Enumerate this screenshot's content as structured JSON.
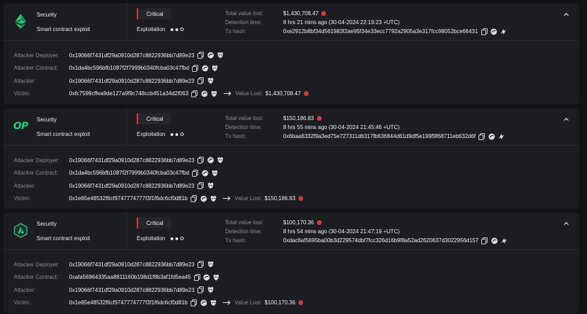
{
  "colors": {
    "background": "#121317",
    "card": "#1c1d22",
    "critical_red": "#d13a3a",
    "optimism_green": "#1ed67a",
    "muted_text": "#8c8e96"
  },
  "labels": {
    "total_value_lost": "Total value lost:",
    "detection_time": "Detection time:",
    "tx_hash": "Tx hash:",
    "attacker_deployer": "Attacker Deployer:",
    "attacker_contract": "Attacker Contract:",
    "attacker": "Attacker:",
    "victim": "Victim:",
    "value_lost": "Value Lost:"
  },
  "incidents": [
    {
      "chain_icon": "ethereum-classic-icon",
      "category": "Security",
      "subcategory": "Smart contract exploit",
      "severity": "Critical",
      "stage": "Exploitation",
      "total_value_lost": "$1,430,708.47",
      "detection_time": "8 hrs 21 mins ago (30-04-2024 22:19:23 +UTC)",
      "tx_hash": "0xe2912b8bf34d561983f2ae95f34e33ecc7792a2905a3e317fcc98052bce66431",
      "attacker_deployer": "0x19066f7431df29a0910d287c8822936bb7d89e23",
      "attacker_contract": "0x1da4bc596bfb1087f2f7999b0340fcba03c47fbd",
      "attacker": "0x19066f7431df29a0910d287c8822936bb7d89e23",
      "victim": "0xfc7599cffea9de127a9f9c748ccb451a34d2f063",
      "victim_value_lost": "$1,430,708.47"
    },
    {
      "chain_icon": "optimism-icon",
      "chain_text": "OP",
      "category": "Security",
      "subcategory": "Smart contract exploit",
      "severity": "Critical",
      "stage": "Exploitation",
      "total_value_lost": "$150,186.83",
      "detection_time": "8 hrs 55 mins ago (30-04-2024 21:45:46 +UTC)",
      "tx_hash": "0x6baa6332f9a3ed75e727311d6317fb636844d61d9df5e199f9f68711eb632d6f",
      "attacker_deployer": "0x19066f7431df29a0910d287c8822936bb7d89e23",
      "attacker_contract": "0x1da4bc596bfb1087f2f7999b0340fcba03c47fbd",
      "attacker": "0x19066f7431df29a0910d287c8822936bb7d89e23",
      "victim": "0x1e65e48532f6cf9747774777f3f1f6dc6cf0d81b",
      "victim_value_lost": "$150,186.83"
    },
    {
      "chain_icon": "arbitrum-icon",
      "category": "Security",
      "subcategory": "Smart contract exploit",
      "severity": "Critical",
      "stage": "Exploitation",
      "total_value_lost": "$100,170.36",
      "detection_time": "8 hrs 54 mins ago (30-04-2024 21:47:19 +UTC)",
      "tx_hash": "0xdac6af5695ba00b3d229574dbf7fcc326d16b9f8a52ad2620637d3022956d157",
      "attacker_deployer": "0x19066f7431df29a0910d287c8822936bb7d89e23",
      "attacker_contract": "0xafa56964335aa8811160b198d1f8b3af1fd5ea45",
      "attacker": "0x19066f7431df29a0910d287c8822936bb7d89e23",
      "victim": "0x1e65e48532f6cf9747774777f3f1f6dc6cf0d81b",
      "victim_value_lost": "$100,170.36"
    }
  ]
}
